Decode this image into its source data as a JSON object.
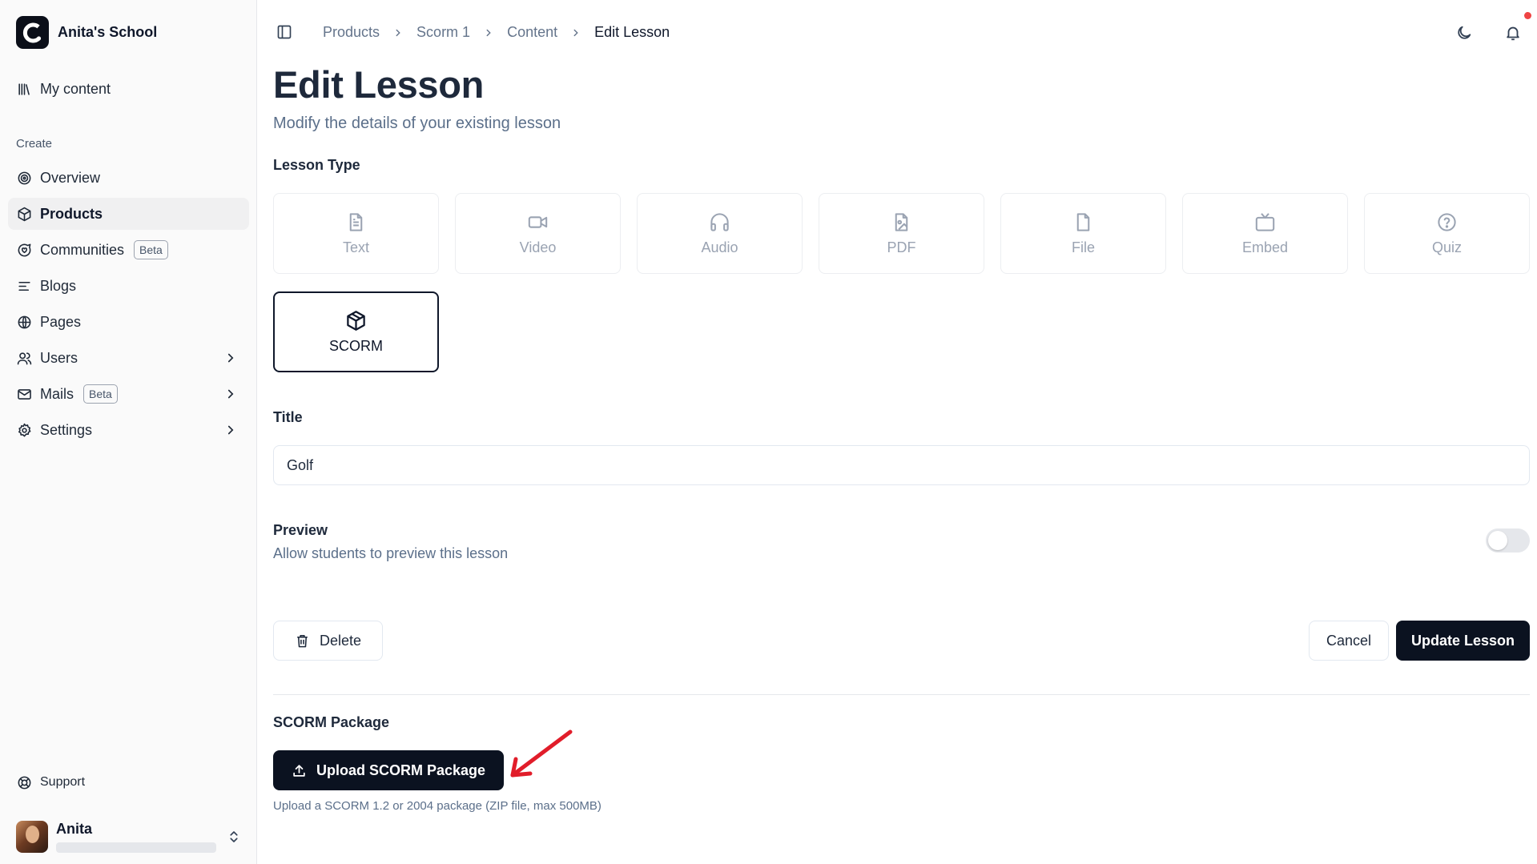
{
  "app": {
    "name": "Anita's School"
  },
  "sidebar": {
    "my_content": "My content",
    "section_create": "Create",
    "items": [
      {
        "label": "Overview",
        "icon": "target-icon"
      },
      {
        "label": "Products",
        "icon": "package-icon",
        "active": true
      },
      {
        "label": "Communities",
        "icon": "message-circle-icon",
        "badge": "Beta"
      },
      {
        "label": "Blogs",
        "icon": "text-lines-icon"
      },
      {
        "label": "Pages",
        "icon": "globe-icon"
      },
      {
        "label": "Users",
        "icon": "users-icon",
        "expandable": true
      },
      {
        "label": "Mails",
        "icon": "mail-icon",
        "badge": "Beta",
        "expandable": true
      },
      {
        "label": "Settings",
        "icon": "gear-icon",
        "expandable": true
      }
    ],
    "support": "Support",
    "user": {
      "name": "Anita"
    }
  },
  "breadcrumb": [
    "Products",
    "Scorm 1",
    "Content",
    "Edit Lesson"
  ],
  "page": {
    "title": "Edit Lesson",
    "subtitle": "Modify the details of your existing lesson"
  },
  "lesson_type": {
    "label": "Lesson Type",
    "options": [
      "Text",
      "Video",
      "Audio",
      "PDF",
      "File",
      "Embed",
      "Quiz",
      "SCORM"
    ],
    "selected": "SCORM"
  },
  "title_field": {
    "label": "Title",
    "value": "Golf"
  },
  "preview": {
    "label": "Preview",
    "description": "Allow students to preview this lesson",
    "enabled": false
  },
  "actions": {
    "delete": "Delete",
    "cancel": "Cancel",
    "update": "Update Lesson"
  },
  "scorm": {
    "label": "SCORM Package",
    "upload_button": "Upload SCORM Package",
    "hint": "Upload a SCORM 1.2 or 2004 package (ZIP file, max 500MB)"
  },
  "colors": {
    "primary": "#0b1220",
    "notification": "#ef4444",
    "annotation_arrow": "#e11d2a"
  }
}
